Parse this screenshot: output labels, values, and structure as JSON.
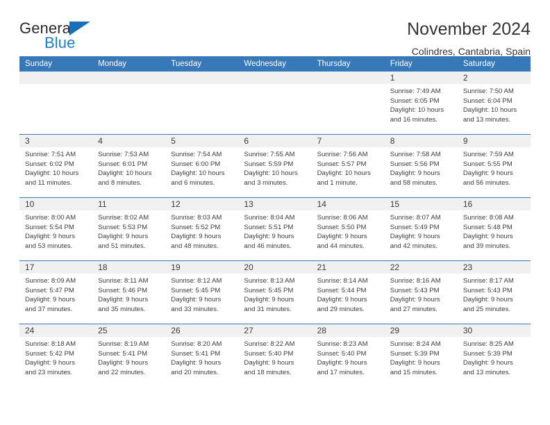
{
  "logo": {
    "word_one": "General",
    "word_two": "Blue",
    "triangle_color": "#1b6fb5"
  },
  "header": {
    "title": "November 2024",
    "subtitle": "Colindres, Cantabria, Spain"
  },
  "colors": {
    "header_blue": "#3778b8",
    "daynum_gray": "#f0f0f0",
    "text": "#3b3b3b"
  },
  "calendar": {
    "weekday_headers": [
      "Sunday",
      "Monday",
      "Tuesday",
      "Wednesday",
      "Thursday",
      "Friday",
      "Saturday"
    ],
    "labels": {
      "sunrise": "Sunrise:",
      "sunset": "Sunset:",
      "daylight": "Daylight:"
    },
    "weeks": [
      [
        {
          "day": "",
          "empty": true,
          "sunrise": "",
          "sunset": "",
          "daylight_1": "",
          "daylight_2": ""
        },
        {
          "day": "",
          "empty": true,
          "sunrise": "",
          "sunset": "",
          "daylight_1": "",
          "daylight_2": ""
        },
        {
          "day": "",
          "empty": true,
          "sunrise": "",
          "sunset": "",
          "daylight_1": "",
          "daylight_2": ""
        },
        {
          "day": "",
          "empty": true,
          "sunrise": "",
          "sunset": "",
          "daylight_1": "",
          "daylight_2": ""
        },
        {
          "day": "",
          "empty": true,
          "sunrise": "",
          "sunset": "",
          "daylight_1": "",
          "daylight_2": ""
        },
        {
          "day": "1",
          "empty": false,
          "sunrise": "Sunrise: 7:49 AM",
          "sunset": "Sunset: 6:05 PM",
          "daylight_1": "Daylight: 10 hours",
          "daylight_2": "and 16 minutes."
        },
        {
          "day": "2",
          "empty": false,
          "sunrise": "Sunrise: 7:50 AM",
          "sunset": "Sunset: 6:04 PM",
          "daylight_1": "Daylight: 10 hours",
          "daylight_2": "and 13 minutes."
        }
      ],
      [
        {
          "day": "3",
          "empty": false,
          "sunrise": "Sunrise: 7:51 AM",
          "sunset": "Sunset: 6:02 PM",
          "daylight_1": "Daylight: 10 hours",
          "daylight_2": "and 11 minutes."
        },
        {
          "day": "4",
          "empty": false,
          "sunrise": "Sunrise: 7:53 AM",
          "sunset": "Sunset: 6:01 PM",
          "daylight_1": "Daylight: 10 hours",
          "daylight_2": "and 8 minutes."
        },
        {
          "day": "5",
          "empty": false,
          "sunrise": "Sunrise: 7:54 AM",
          "sunset": "Sunset: 6:00 PM",
          "daylight_1": "Daylight: 10 hours",
          "daylight_2": "and 6 minutes."
        },
        {
          "day": "6",
          "empty": false,
          "sunrise": "Sunrise: 7:55 AM",
          "sunset": "Sunset: 5:59 PM",
          "daylight_1": "Daylight: 10 hours",
          "daylight_2": "and 3 minutes."
        },
        {
          "day": "7",
          "empty": false,
          "sunrise": "Sunrise: 7:56 AM",
          "sunset": "Sunset: 5:57 PM",
          "daylight_1": "Daylight: 10 hours",
          "daylight_2": "and 1 minute."
        },
        {
          "day": "8",
          "empty": false,
          "sunrise": "Sunrise: 7:58 AM",
          "sunset": "Sunset: 5:56 PM",
          "daylight_1": "Daylight: 9 hours",
          "daylight_2": "and 58 minutes."
        },
        {
          "day": "9",
          "empty": false,
          "sunrise": "Sunrise: 7:59 AM",
          "sunset": "Sunset: 5:55 PM",
          "daylight_1": "Daylight: 9 hours",
          "daylight_2": "and 56 minutes."
        }
      ],
      [
        {
          "day": "10",
          "empty": false,
          "sunrise": "Sunrise: 8:00 AM",
          "sunset": "Sunset: 5:54 PM",
          "daylight_1": "Daylight: 9 hours",
          "daylight_2": "and 53 minutes."
        },
        {
          "day": "11",
          "empty": false,
          "sunrise": "Sunrise: 8:02 AM",
          "sunset": "Sunset: 5:53 PM",
          "daylight_1": "Daylight: 9 hours",
          "daylight_2": "and 51 minutes."
        },
        {
          "day": "12",
          "empty": false,
          "sunrise": "Sunrise: 8:03 AM",
          "sunset": "Sunset: 5:52 PM",
          "daylight_1": "Daylight: 9 hours",
          "daylight_2": "and 48 minutes."
        },
        {
          "day": "13",
          "empty": false,
          "sunrise": "Sunrise: 8:04 AM",
          "sunset": "Sunset: 5:51 PM",
          "daylight_1": "Daylight: 9 hours",
          "daylight_2": "and 46 minutes."
        },
        {
          "day": "14",
          "empty": false,
          "sunrise": "Sunrise: 8:06 AM",
          "sunset": "Sunset: 5:50 PM",
          "daylight_1": "Daylight: 9 hours",
          "daylight_2": "and 44 minutes."
        },
        {
          "day": "15",
          "empty": false,
          "sunrise": "Sunrise: 8:07 AM",
          "sunset": "Sunset: 5:49 PM",
          "daylight_1": "Daylight: 9 hours",
          "daylight_2": "and 42 minutes."
        },
        {
          "day": "16",
          "empty": false,
          "sunrise": "Sunrise: 8:08 AM",
          "sunset": "Sunset: 5:48 PM",
          "daylight_1": "Daylight: 9 hours",
          "daylight_2": "and 39 minutes."
        }
      ],
      [
        {
          "day": "17",
          "empty": false,
          "sunrise": "Sunrise: 8:09 AM",
          "sunset": "Sunset: 5:47 PM",
          "daylight_1": "Daylight: 9 hours",
          "daylight_2": "and 37 minutes."
        },
        {
          "day": "18",
          "empty": false,
          "sunrise": "Sunrise: 8:11 AM",
          "sunset": "Sunset: 5:46 PM",
          "daylight_1": "Daylight: 9 hours",
          "daylight_2": "and 35 minutes."
        },
        {
          "day": "19",
          "empty": false,
          "sunrise": "Sunrise: 8:12 AM",
          "sunset": "Sunset: 5:45 PM",
          "daylight_1": "Daylight: 9 hours",
          "daylight_2": "and 33 minutes."
        },
        {
          "day": "20",
          "empty": false,
          "sunrise": "Sunrise: 8:13 AM",
          "sunset": "Sunset: 5:45 PM",
          "daylight_1": "Daylight: 9 hours",
          "daylight_2": "and 31 minutes."
        },
        {
          "day": "21",
          "empty": false,
          "sunrise": "Sunrise: 8:14 AM",
          "sunset": "Sunset: 5:44 PM",
          "daylight_1": "Daylight: 9 hours",
          "daylight_2": "and 29 minutes."
        },
        {
          "day": "22",
          "empty": false,
          "sunrise": "Sunrise: 8:16 AM",
          "sunset": "Sunset: 5:43 PM",
          "daylight_1": "Daylight: 9 hours",
          "daylight_2": "and 27 minutes."
        },
        {
          "day": "23",
          "empty": false,
          "sunrise": "Sunrise: 8:17 AM",
          "sunset": "Sunset: 5:43 PM",
          "daylight_1": "Daylight: 9 hours",
          "daylight_2": "and 25 minutes."
        }
      ],
      [
        {
          "day": "24",
          "empty": false,
          "sunrise": "Sunrise: 8:18 AM",
          "sunset": "Sunset: 5:42 PM",
          "daylight_1": "Daylight: 9 hours",
          "daylight_2": "and 23 minutes."
        },
        {
          "day": "25",
          "empty": false,
          "sunrise": "Sunrise: 8:19 AM",
          "sunset": "Sunset: 5:41 PM",
          "daylight_1": "Daylight: 9 hours",
          "daylight_2": "and 22 minutes."
        },
        {
          "day": "26",
          "empty": false,
          "sunrise": "Sunrise: 8:20 AM",
          "sunset": "Sunset: 5:41 PM",
          "daylight_1": "Daylight: 9 hours",
          "daylight_2": "and 20 minutes."
        },
        {
          "day": "27",
          "empty": false,
          "sunrise": "Sunrise: 8:22 AM",
          "sunset": "Sunset: 5:40 PM",
          "daylight_1": "Daylight: 9 hours",
          "daylight_2": "and 18 minutes."
        },
        {
          "day": "28",
          "empty": false,
          "sunrise": "Sunrise: 8:23 AM",
          "sunset": "Sunset: 5:40 PM",
          "daylight_1": "Daylight: 9 hours",
          "daylight_2": "and 17 minutes."
        },
        {
          "day": "29",
          "empty": false,
          "sunrise": "Sunrise: 8:24 AM",
          "sunset": "Sunset: 5:39 PM",
          "daylight_1": "Daylight: 9 hours",
          "daylight_2": "and 15 minutes."
        },
        {
          "day": "30",
          "empty": false,
          "sunrise": "Sunrise: 8:25 AM",
          "sunset": "Sunset: 5:39 PM",
          "daylight_1": "Daylight: 9 hours",
          "daylight_2": "and 13 minutes."
        }
      ]
    ]
  }
}
